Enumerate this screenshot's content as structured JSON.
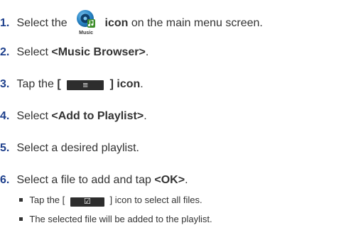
{
  "steps": [
    {
      "number": "1.",
      "before": "Select the",
      "icon_label": "Music",
      "bold": "icon",
      "after": "on the main menu screen."
    },
    {
      "number": "2.",
      "before": "Select",
      "bold": "<Music Browser>",
      "after": "."
    },
    {
      "number": "3.",
      "before": "Tap the",
      "bracket_open": "[",
      "icon_glyph": "≡",
      "bold": "] icon",
      "after": "."
    },
    {
      "number": "4.",
      "before": "Select",
      "bold": "<Add to Playlist>",
      "after": "."
    },
    {
      "number": "5.",
      "text": "Select a desired playlist."
    },
    {
      "number": "6.",
      "before": "Select a file to add and tap",
      "bold": "<OK>",
      "after": "."
    }
  ],
  "notes": [
    {
      "before": "Tap the [",
      "icon_glyph": "☑",
      "after": "] icon to select all files."
    },
    {
      "text": "The selected file will be added to the playlist."
    }
  ],
  "colors": {
    "number": "#1d3f8c",
    "text": "#333333",
    "chip": "#2d2d2d"
  },
  "icons": {
    "step1": "music-app-icon",
    "step3": "menu-icon",
    "note1": "select-all-checkbox-icon"
  }
}
